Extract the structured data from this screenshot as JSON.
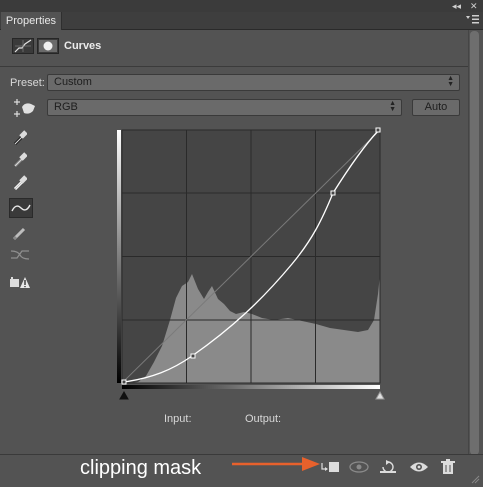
{
  "panel": {
    "tab": "Properties",
    "title": "Curves"
  },
  "preset": {
    "label": "Preset:",
    "value": "Custom"
  },
  "channel": {
    "value": "RGB",
    "auto_label": "Auto"
  },
  "readout": {
    "input_label": "Input:",
    "output_label": "Output:"
  },
  "annotation": {
    "text": "clipping mask",
    "color": "#e8612c"
  },
  "icons": {
    "header": [
      "curves-adjustment-icon",
      "layer-mask-icon"
    ],
    "tools": [
      "targeted-adjustment-hand-icon",
      "black-point-eyedropper-icon",
      "gray-point-eyedropper-icon",
      "white-point-eyedropper-icon",
      "edit-points-curve-icon",
      "pencil-draw-icon",
      "smooth-curve-icon",
      "clipping-warning-icon"
    ],
    "bottom": [
      "clip-to-layer-icon",
      "view-previous-state-icon",
      "reset-icon",
      "visibility-eye-icon",
      "delete-trash-icon"
    ]
  }
}
